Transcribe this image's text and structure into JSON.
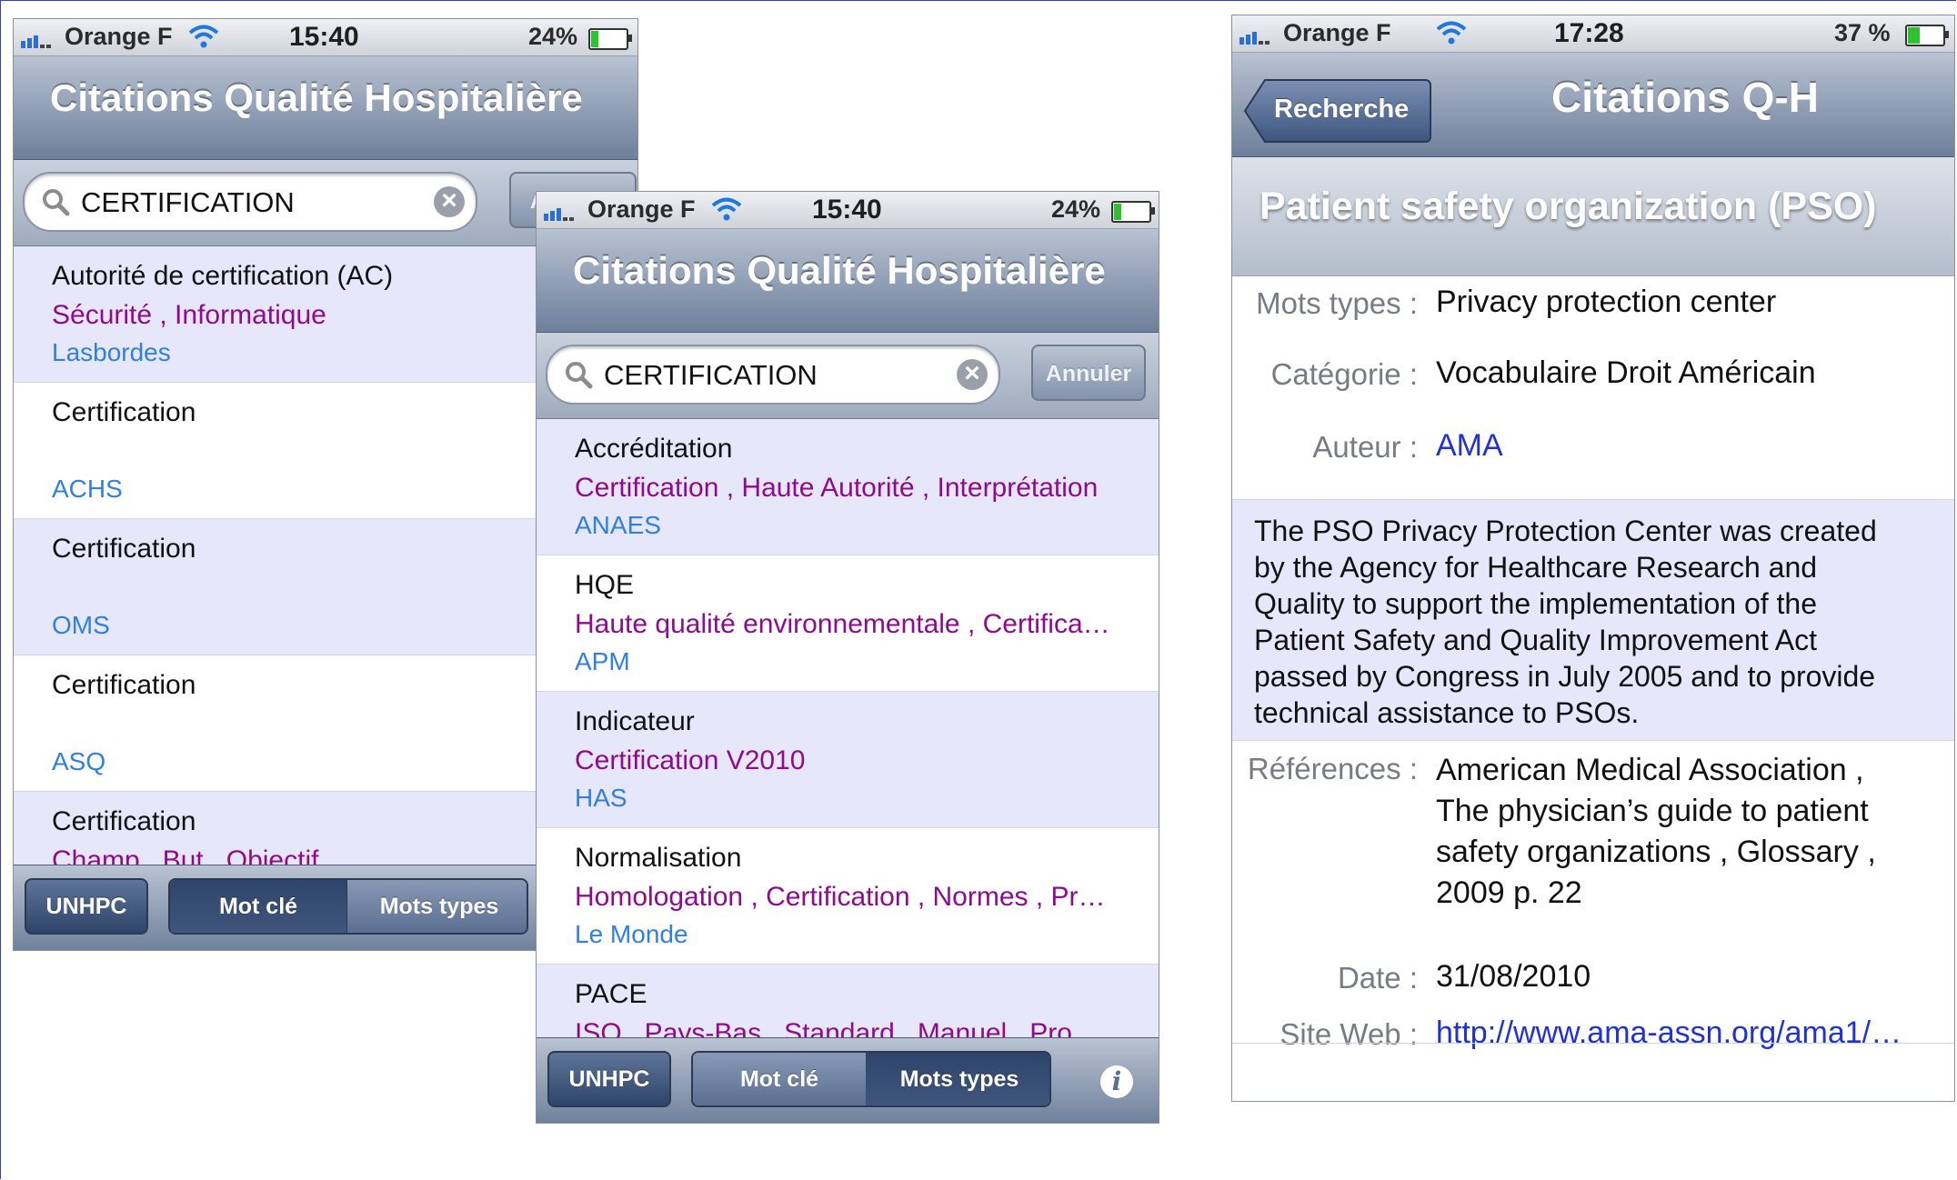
{
  "status_left": {
    "carrier": "Orange F",
    "time": "15:40",
    "battery": "24%",
    "battery_level": 0.24
  },
  "status_right": {
    "carrier": "Orange F",
    "time": "17:28",
    "battery": "37 %",
    "battery_level": 0.37
  },
  "app_title": "Citations Qualité Hospitalière",
  "search": {
    "query": "CERTIFICATION",
    "cancel": "Annuler",
    "clear_glyph": "×"
  },
  "screen1_rows": [
    {
      "title": "Autorité de certification (AC)",
      "keywords": "Sécurité , Informatique",
      "author": "Lasbordes"
    },
    {
      "title": "Certification",
      "keywords": "",
      "author": "ACHS"
    },
    {
      "title": "Certification",
      "keywords": "",
      "author": "OMS"
    },
    {
      "title": "Certification",
      "keywords": "",
      "author": "ASQ"
    },
    {
      "title": "Certification",
      "keywords": "Champ , But , Objectif",
      "author": ""
    }
  ],
  "screen2_rows": [
    {
      "title": "Accréditation",
      "keywords": "Certification , Haute Autorité , Interprétation",
      "author": "ANAES"
    },
    {
      "title": "HQE",
      "keywords": "Haute qualité environnementale , Certifica…",
      "author": "APM"
    },
    {
      "title": "Indicateur",
      "keywords": "Certification V2010",
      "author": "HAS"
    },
    {
      "title": "Normalisation",
      "keywords": "Homologation , Certification , Normes , Pr…",
      "author": "Le Monde"
    },
    {
      "title": "PACE",
      "keywords": "ISO , Pays-Bas , Standard , Manuel , Pro…",
      "author": ""
    }
  ],
  "toolbar": {
    "unhpc": "UNHPC",
    "mot_cle": "Mot clé",
    "mots_types": "Mots types",
    "info": "i"
  },
  "detail": {
    "back": "Recherche",
    "nav_title": "Citations Q-H",
    "heading": "Patient safety organization (PSO)",
    "mots_types_label": "Mots types :",
    "mots_types_value": "Privacy protection center",
    "categorie_label": "Catégorie :",
    "categorie_value": "Vocabulaire Droit Américain",
    "auteur_label": "Auteur :",
    "auteur_value": "AMA",
    "quote_lines": [
      "The PSO Privacy Protection Center was created",
      "by the Agency for Healthcare Research and",
      "Quality to support the implementation of the",
      "Patient Safety and Quality Improvement Act",
      "passed by Congress in July 2005 and to provide",
      "technical assistance to PSOs."
    ],
    "references_label": "Références :",
    "references_lines": [
      "American Medical Association ,",
      "The physician’s guide to patient",
      "safety organizations , Glossary ,",
      "2009 p. 22"
    ],
    "date_label": "Date :",
    "date_value": "31/08/2010",
    "site_label": "Site Web :",
    "site_value": "http://www.ama-assn.org/ama1/…"
  },
  "colors": {
    "keyword": "#8e0a8e",
    "author": "#2f80e0",
    "link": "#1f32d6",
    "alt_row": "#e6e7fb"
  }
}
